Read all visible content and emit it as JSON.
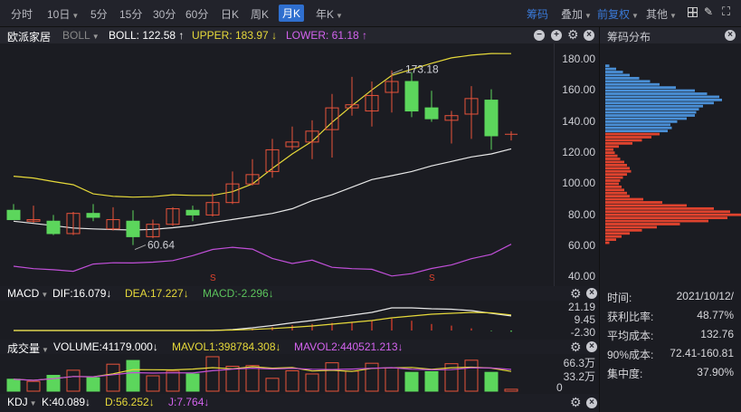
{
  "toolbar": {
    "periods": [
      "分时",
      "10日",
      "5分",
      "15分",
      "30分",
      "60分",
      "日K",
      "周K",
      "月K",
      "年K"
    ],
    "active": "月K",
    "right": {
      "chips": "筹码",
      "overlay": "叠加",
      "adjust": "前复权",
      "other": "其他"
    }
  },
  "title": {
    "stock": "欧派家居",
    "indicator": "BOLL",
    "boll": "BOLL: 122.58",
    "boll_arrow": "↑",
    "upper": "UPPER: 183.97",
    "upper_arrow": "↓",
    "lower": "LOWER: 61.18",
    "lower_arrow": "↑"
  },
  "right_panel": {
    "title": "筹码分布",
    "stats": [
      {
        "label": "时间:",
        "value": "2021/10/12/"
      },
      {
        "label": "获利比率:",
        "value": "48.77%"
      },
      {
        "label": "平均成本:",
        "value": "132.76"
      },
      {
        "label": "90%成本:",
        "value": "72.41-160.81"
      },
      {
        "label": "集中度:",
        "value": "37.90%"
      }
    ]
  },
  "price_axis": [
    "180.00",
    "160.00",
    "140.00",
    "120.00",
    "100.00",
    "80.00",
    "60.00",
    "40.00"
  ],
  "annotations": {
    "high": "173.18",
    "low": "60.64",
    "signal": "S"
  },
  "macd": {
    "name": "MACD",
    "dif": "DIF:16.079↓",
    "dea": "DEA:17.227↓",
    "macd": "MACD:-2.296↓",
    "axis": [
      "21.19",
      "9.45",
      "-2.30"
    ]
  },
  "volume": {
    "name": "成交量",
    "volume": "VOLUME:41179.000↓",
    "mavol1": "MAVOL1:398784.308↓",
    "mavol2": "MAVOL2:440521.213↓",
    "axis": [
      "66.3万",
      "33.2万",
      "0"
    ]
  },
  "kdj": {
    "name": "KDJ",
    "k": "K:40.089↓",
    "d": "D:56.252↓",
    "j": "J:7.764↓"
  },
  "colors": {
    "up": "#e8533b",
    "down": "#5cd65c",
    "upper": "#e6d93a",
    "mid": "#e8e8e8",
    "lower": "#c04fd8",
    "chip_profit": "#4a8fd6",
    "chip_loss": "#e0432e"
  },
  "chart_data": {
    "type": "candlestick",
    "ohlc": [
      [
        83,
        87,
        77,
        77
      ],
      [
        76,
        86,
        75,
        77
      ],
      [
        76,
        80,
        67,
        68
      ],
      [
        68,
        82,
        67,
        81
      ],
      [
        81,
        87,
        76,
        78.5
      ],
      [
        71,
        85,
        70,
        77
      ],
      [
        76,
        83,
        60.64,
        66
      ],
      [
        66,
        77,
        65,
        74
      ],
      [
        74,
        85,
        73,
        84
      ],
      [
        83,
        86,
        76,
        80
      ],
      [
        80,
        94,
        79,
        88
      ],
      [
        88,
        108,
        87,
        100
      ],
      [
        100,
        116,
        99,
        106
      ],
      [
        108,
        129,
        104,
        122
      ],
      [
        124,
        137,
        122,
        127
      ],
      [
        127,
        141,
        116,
        134
      ],
      [
        135,
        158,
        117,
        149
      ],
      [
        149,
        169,
        144,
        151
      ],
      [
        147,
        166,
        137,
        157
      ],
      [
        159,
        173.18,
        146,
        166
      ],
      [
        166,
        172,
        143,
        147
      ],
      [
        149,
        160,
        140,
        142
      ],
      [
        141,
        147,
        126,
        144
      ],
      [
        145,
        163,
        129,
        155
      ],
      [
        154,
        161,
        122,
        131
      ],
      [
        132,
        134,
        128,
        132
      ]
    ],
    "boll_upper": [
      105,
      103.8,
      101.5,
      99.5,
      93.6,
      92,
      91.5,
      91.8,
      93,
      92.6,
      92.6,
      95,
      100,
      110,
      119.3,
      127.5,
      139.7,
      150.4,
      160.6,
      169.9,
      173.8,
      177.7,
      181.2,
      183,
      184,
      183.97
    ],
    "boll_mid": [
      76,
      74.6,
      73.1,
      71.6,
      71,
      70.6,
      70.3,
      70.7,
      71.8,
      73.2,
      75.2,
      77.1,
      79,
      81,
      84,
      89.2,
      93,
      97.9,
      102.8,
      105.3,
      108,
      111.6,
      114.5,
      117.4,
      119.3,
      122.58
    ],
    "boll_lower": [
      47,
      45.4,
      44.7,
      43.7,
      48.4,
      49.2,
      49.1,
      49.6,
      50.6,
      53.8,
      57.8,
      59.2,
      58,
      52,
      48.7,
      50.9,
      46.3,
      45.4,
      45,
      40.7,
      42.2,
      45.5,
      47.8,
      51.8,
      54.6,
      61.18
    ],
    "signals": [
      {
        "index": 10,
        "label": "S"
      },
      {
        "index": 21,
        "label": "S"
      }
    ],
    "price_range": [
      40,
      180
    ],
    "dif": [
      0,
      0,
      0,
      0,
      0,
      0,
      0,
      0,
      0,
      0,
      0,
      1,
      3,
      5.5,
      8.5,
      11,
      14,
      17,
      20,
      25,
      25,
      24,
      23.5,
      22,
      19,
      16.079
    ],
    "dea": [
      0,
      0,
      0,
      0,
      0,
      0,
      0,
      0,
      0,
      0,
      0.2,
      0.5,
      1.2,
      2.2,
      3.5,
      5,
      7,
      9,
      11,
      14,
      16,
      18,
      19,
      20,
      19.5,
      17.227
    ],
    "volume_wan": [
      25.7,
      21,
      34,
      45,
      29,
      58,
      66,
      33,
      43,
      37,
      74,
      53.5,
      55,
      27.6,
      43.8,
      37,
      61,
      43,
      60,
      50,
      40.5,
      42,
      59,
      66.5,
      40.5,
      4.1
    ],
    "chips": {
      "prices": [
        176,
        174,
        172,
        170,
        168,
        166,
        164,
        162,
        160,
        158,
        156,
        154,
        152,
        150,
        148,
        146,
        144,
        142,
        140,
        138,
        136,
        134,
        132,
        130,
        128,
        126,
        124,
        122,
        120,
        118,
        116,
        114,
        112,
        110,
        108,
        106,
        104,
        102,
        100,
        98,
        96,
        94,
        92,
        90,
        88,
        86,
        84,
        82,
        80,
        78,
        76,
        74,
        72,
        70,
        68,
        66,
        64,
        62
      ],
      "weights": [
        3,
        8,
        13,
        18,
        25,
        33,
        40,
        52,
        66,
        75,
        84,
        86,
        80,
        72,
        69,
        67,
        66,
        60,
        53,
        48,
        49,
        46,
        40,
        34,
        27,
        20,
        10,
        6,
        7,
        9,
        11,
        14,
        16,
        18,
        19,
        16,
        13,
        11,
        10,
        12,
        14,
        16,
        18,
        28,
        42,
        60,
        80,
        92,
        100,
        90,
        76,
        55,
        38,
        27,
        18,
        12,
        8,
        3
      ],
      "split_price": 133
    }
  }
}
